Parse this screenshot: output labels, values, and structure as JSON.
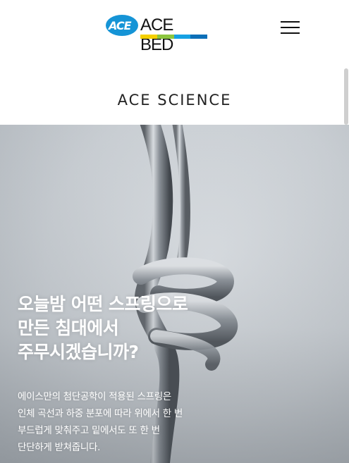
{
  "header": {
    "logo": {
      "badge_text": "ACE",
      "wordmark": "ACE BED",
      "stripe_colors": [
        "#f5d000",
        "#8cc63f",
        "#16a1e3",
        "#0d6fb8"
      ]
    },
    "menu_icon": "hamburger-menu-icon"
  },
  "section": {
    "title": "ACE SCIENCE"
  },
  "hero": {
    "image": "metal-coil-spring-image",
    "headline": [
      "오늘밤 어떤 스프링으로",
      "만든 침대에서",
      "주무시겠습니까?"
    ],
    "description": [
      "에이스만의 첨단공학이 적용된 스프링은",
      "인체 곡선과 하중 분포에 따라 위에서 한 번",
      "부드럽게 맞춰주고 밑에서도 또 한 번",
      "단단하게 받쳐줍니다."
    ]
  },
  "colors": {
    "brand_blue": "#1594d6",
    "text_dark": "#222222",
    "hero_text": "#ffffff"
  }
}
